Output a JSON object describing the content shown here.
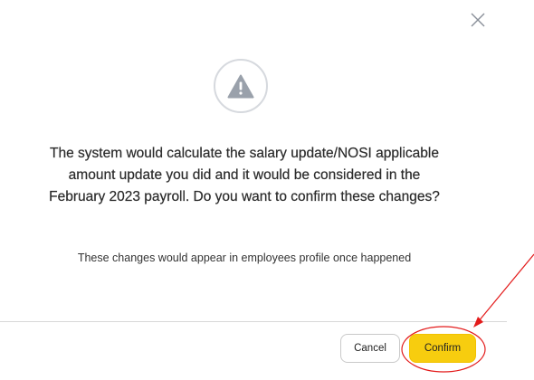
{
  "dialog": {
    "close_icon": "close-icon",
    "alert_icon": "warning-triangle-icon",
    "message": "The system would calculate the salary update/NOSI applicable amount update you did and it would be considered in the February 2023 payroll. Do you want to confirm these changes?",
    "sub_message": "These changes would appear in employees profile once happened",
    "cancel_label": "Cancel",
    "confirm_label": "Confirm"
  },
  "colors": {
    "confirm_button": "#f7cd0f",
    "annotation": "#e31b1b",
    "icon_gray": "#9aa1ab"
  }
}
